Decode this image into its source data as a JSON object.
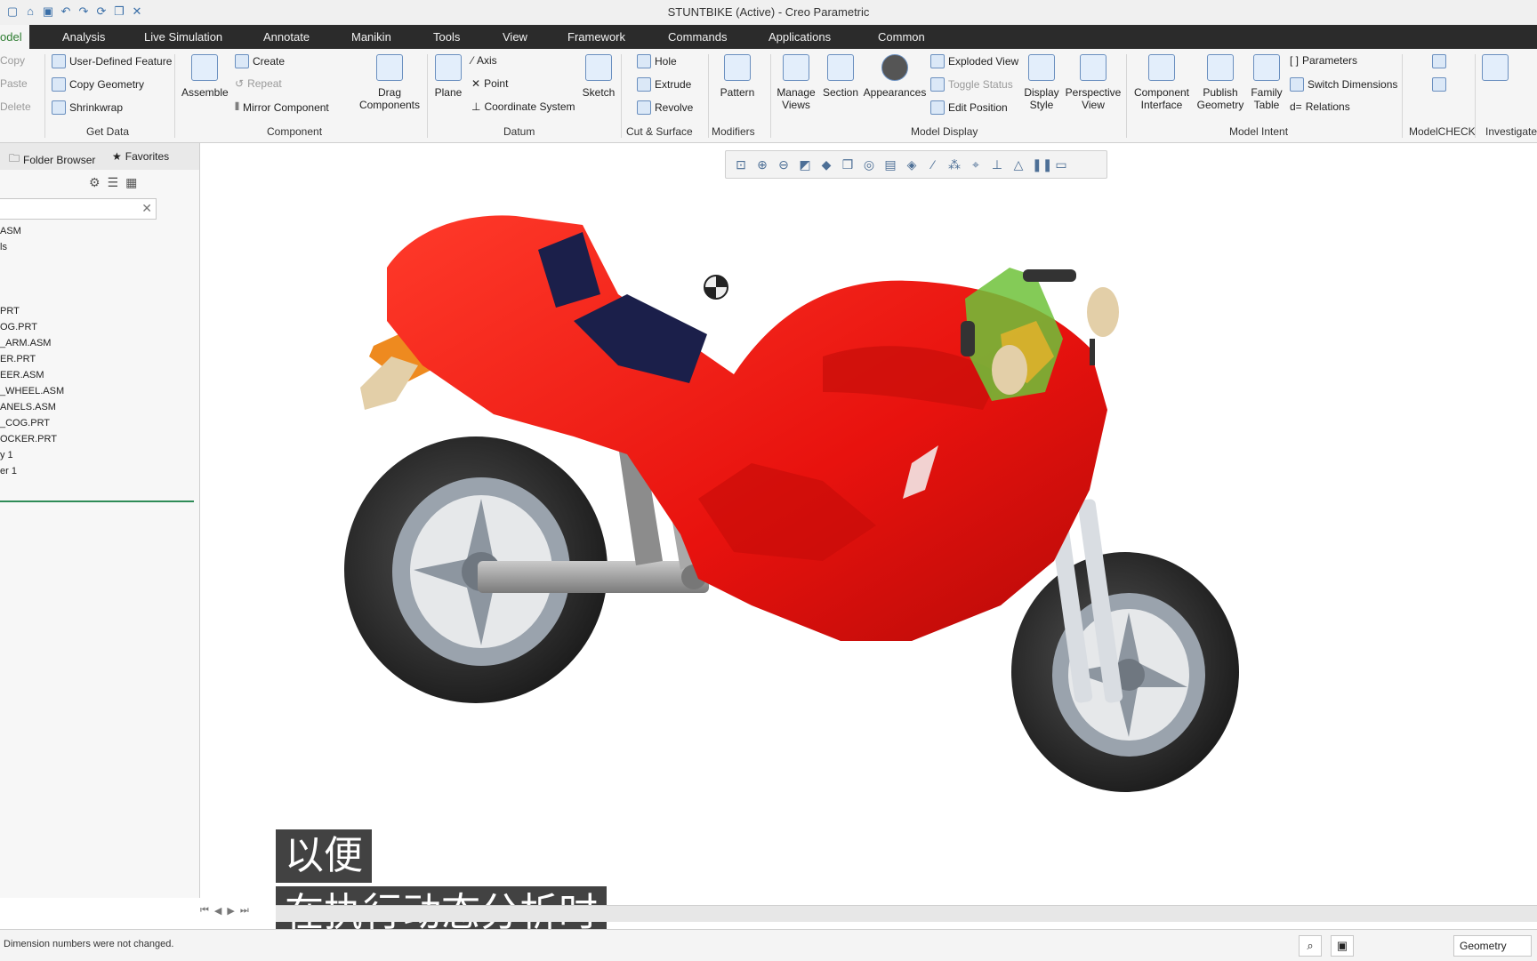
{
  "window": {
    "title": "STUNTBIKE (Active) - Creo Parametric"
  },
  "qat_icons": [
    "new-file-icon",
    "open-icon",
    "save-icon",
    "undo-icon",
    "redo-icon",
    "regenerate-icon",
    "window-icon",
    "close-icon"
  ],
  "tabs": [
    {
      "label": "odel",
      "active": true
    },
    {
      "label": "Analysis"
    },
    {
      "label": "Live Simulation"
    },
    {
      "label": "Annotate"
    },
    {
      "label": "Manikin"
    },
    {
      "label": "Tools"
    },
    {
      "label": "View"
    },
    {
      "label": "Framework"
    },
    {
      "label": "Commands"
    },
    {
      "label": "Applications"
    },
    {
      "label": "Common"
    }
  ],
  "ribbon": {
    "ops": {
      "copy": "Copy",
      "paste": "Paste",
      "delete": "Delete"
    },
    "get_data": {
      "label": "Get Data",
      "udf": "User-Defined Feature",
      "copy_geometry": "Copy Geometry",
      "shrinkwrap": "Shrinkwrap"
    },
    "component": {
      "label": "Component",
      "assemble": "Assemble",
      "create": "Create",
      "repeat": "Repeat",
      "mirror": "Mirror Component",
      "drag": "Drag Components"
    },
    "datum": {
      "label": "Datum",
      "plane": "Plane",
      "axis": "Axis",
      "point": "Point",
      "csys": "Coordinate System",
      "sketch": "Sketch"
    },
    "cut_surface": {
      "label": "Cut & Surface",
      "hole": "Hole",
      "extrude": "Extrude",
      "revolve": "Revolve"
    },
    "modifiers": {
      "label": "Modifiers",
      "pattern": "Pattern"
    },
    "model_display": {
      "label": "Model Display",
      "manage_views": "Manage Views",
      "section": "Section",
      "appearances": "Appearances",
      "exploded": "Exploded View",
      "toggle_status": "Toggle Status",
      "edit_position": "Edit Position",
      "display_style": "Display Style",
      "perspective": "Perspective View"
    },
    "model_intent": {
      "label": "Model Intent",
      "component_interface": "Component Interface",
      "publish_geometry": "Publish Geometry",
      "family_table": "Family Table",
      "parameters": "Parameters",
      "switch_dimensions": "Switch Dimensions",
      "relations": "Relations"
    },
    "modelcheck": {
      "label": "ModelCHECK"
    },
    "investigate": {
      "label": "Investigate"
    }
  },
  "sidebar": {
    "tabs": {
      "folder_browser": "Folder Browser",
      "favorites": "Favorites"
    },
    "search_placeholder": "",
    "tree": [
      "ASM",
      "ls",
      "",
      "",
      "",
      "PRT",
      "OG.PRT",
      "_ARM.ASM",
      "ER.PRT",
      "EER.ASM",
      "_WHEEL.ASM",
      "ANELS.ASM",
      "_COG.PRT",
      "OCKER.PRT",
      "y 1",
      "er 1"
    ]
  },
  "status": {
    "message": "Dimension numbers were not changed.",
    "filter": "Geometry"
  },
  "subtitles": {
    "line1": "以便",
    "line2": "在执行动态分析时"
  },
  "colors": {
    "tab_bar": "#2b2b2b",
    "body_red": "#e8120e",
    "seat_navy": "#1b1f4a",
    "accent_green": "#2e7d32"
  }
}
